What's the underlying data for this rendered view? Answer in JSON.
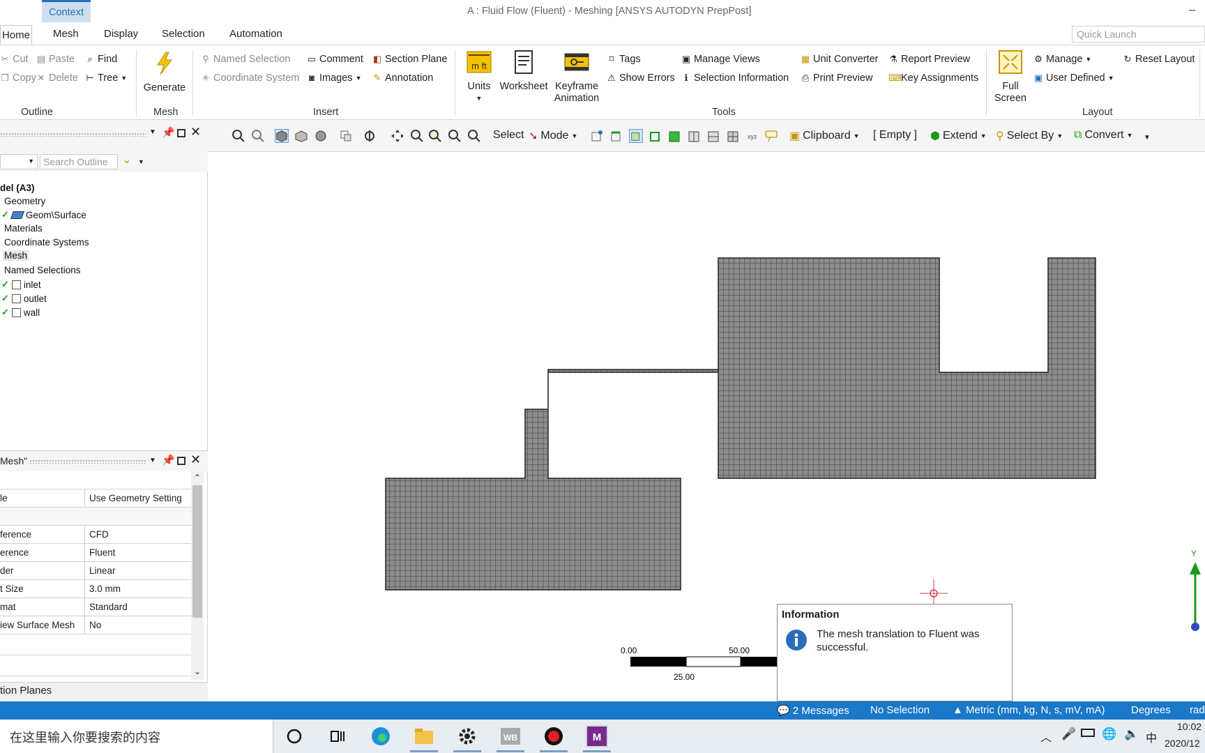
{
  "window": {
    "title": "A : Fluid Flow (Fluent) - Meshing [ANSYS AUTODYN PrepPost]",
    "context_tab": "Context",
    "minimize": "–"
  },
  "tabs": [
    "Home",
    "Mesh",
    "Display",
    "Selection",
    "Automation"
  ],
  "quick_launch": {
    "placeholder": "Quick Launch"
  },
  "ribbon": {
    "outline": {
      "cut": "Cut",
      "paste": "Paste",
      "find": "Find",
      "copy": "Copy",
      "delete": "Delete",
      "tree": "Tree",
      "group": "Outline"
    },
    "mesh": {
      "generate": "Generate",
      "group": "Mesh"
    },
    "insert": {
      "named_selection": "Named Selection",
      "comment": "Comment",
      "section_plane": "Section Plane",
      "coordinate_system": "Coordinate System",
      "images": "Images",
      "annotation": "Annotation",
      "group": "Insert"
    },
    "tools": {
      "units_top": "m ft",
      "units": "Units",
      "worksheet": "Worksheet",
      "keyframe_1": "Keyframe",
      "keyframe_2": "Animation",
      "tags": "Tags",
      "show_errors": "Show Errors",
      "manage_views": "Manage Views",
      "selection_information": "Selection Information",
      "unit_converter": "Unit Converter",
      "print_preview": "Print Preview",
      "report_preview": "Report Preview",
      "key_assignments": "Key Assignments",
      "group": "Tools"
    },
    "layout": {
      "full_1": "Full",
      "full_2": "Screen",
      "manage": "Manage",
      "user_defined": "User Defined",
      "reset_layout": "Reset Layout",
      "group": "Layout"
    }
  },
  "toolbar": {
    "select": "Select",
    "mode": "Mode",
    "clipboard": "Clipboard",
    "empty": "[ Empty ]",
    "extend": "Extend",
    "select_by": "Select By",
    "convert": "Convert"
  },
  "outline": {
    "search_placeholder": "Search Outline",
    "tree": [
      "del (A3)",
      "Geometry",
      "Geom\\Surface",
      "Materials",
      "Coordinate Systems",
      "Mesh",
      "Named Selections",
      "inlet",
      "outlet",
      "wall"
    ]
  },
  "details": {
    "title": "Mesh\"",
    "rows": [
      {
        "k": "le",
        "v": "Use Geometry Setting"
      },
      {
        "k": "",
        "v": ""
      },
      {
        "k": "ference",
        "v": "CFD"
      },
      {
        "k": "erence",
        "v": "Fluent"
      },
      {
        "k": "der",
        "v": "Linear"
      },
      {
        "k": "t Size",
        "v": "3.0 mm"
      },
      {
        "k": "mat",
        "v": "Standard"
      },
      {
        "k": "iew Surface Mesh",
        "v": "No"
      },
      {
        "k": "",
        "v": ""
      },
      {
        "k": "",
        "v": ""
      }
    ],
    "section_planes": "tion Planes"
  },
  "viewport": {
    "scale": {
      "l0": "0.00",
      "l50": "50.00",
      "l25": "25.00"
    },
    "axis_y": "Y",
    "info": {
      "title": "Information",
      "text": "The mesh translation to Fluent was successful."
    }
  },
  "status": {
    "messages": "2 Messages",
    "selection": "No Selection",
    "units": "Metric (mm, kg, N, s, mV, mA)",
    "degrees": "Degrees",
    "rad": "rad"
  },
  "taskbar": {
    "search": "在这里输入你要搜索的内容",
    "ime": "中",
    "time": "10:02",
    "date": "2020/12"
  },
  "colors": {
    "accent": "#1978c8",
    "mesh_fill": "#8c8c8c",
    "mesh_line": "#3a3a3a"
  }
}
